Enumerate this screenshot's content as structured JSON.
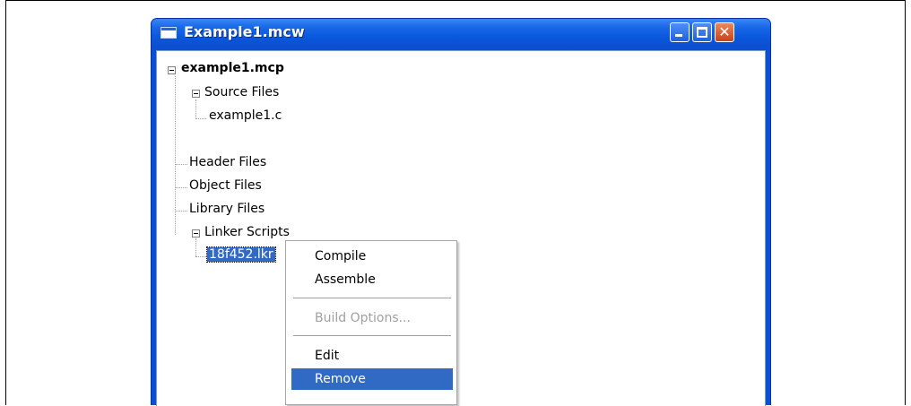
{
  "window": {
    "title": "Example1.mcw",
    "minimize_label": "_",
    "maximize_label": "□",
    "close_label": "✕"
  },
  "tree": {
    "root": "example1.mcp",
    "source_files": "Source Files",
    "source_child": "example1.c",
    "header_files": "Header Files",
    "object_files": "Object Files",
    "library_files": "Library Files",
    "linker_scripts": "Linker Scripts",
    "linker_child": "18f452.lkr"
  },
  "context_menu": {
    "compile": "Compile",
    "assemble": "Assemble",
    "build_options": "Build Options...",
    "edit": "Edit",
    "remove": "Remove"
  },
  "colors": {
    "title_blue": "#0a56dc",
    "selection": "#316ac5"
  }
}
